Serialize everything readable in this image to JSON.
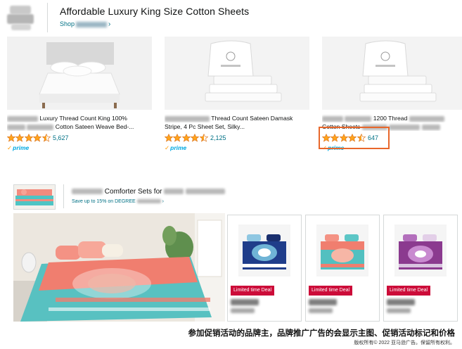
{
  "banner_top": {
    "headline": "Affordable Luxury King Size Cotton Sheets",
    "shop_prefix": "Shop",
    "shop_chevron": "›",
    "products": [
      {
        "title_line1": "Luxury Thread Count King 100%",
        "title_line2": "Cotton Sateen Weave Bed-...",
        "rating": 4.5,
        "review_count": "5,627",
        "prime": "prime"
      },
      {
        "title_line1": "Thread Count Sateen Damask",
        "title_line2": "Stripe, 4 Pc Sheet Set, Silky...",
        "rating": 4.5,
        "review_count": "2,125",
        "prime": "prime"
      },
      {
        "title_line1": "1200 Thread",
        "title_line2": "Cotton Sheets",
        "rating": 4.5,
        "review_count": "647",
        "prime": "prime"
      }
    ]
  },
  "banner_bottom": {
    "headline": "Comforter Sets for",
    "save_text": "Save up to 15% on DEGREE",
    "save_chevron": "›",
    "deals": [
      {
        "badge": "Limited time Deal",
        "accent": "#1f3d8a"
      },
      {
        "badge": "Limited time Deal",
        "accent": "#e36b5f"
      },
      {
        "badge": "Limited time Deal",
        "accent": "#8b3a8f"
      }
    ]
  },
  "caption": "参加促销活动的品牌主，品牌推广广告的会显示主图、促销活动标记和价格",
  "copyright": "版权所有© 2022 亚马逊广告。保留所有权利。",
  "colors": {
    "link": "#007185",
    "star": "#ffa41c",
    "deal_badge": "#cc0c39",
    "highlight": "#e8672b",
    "prime": "#00a8e1"
  }
}
